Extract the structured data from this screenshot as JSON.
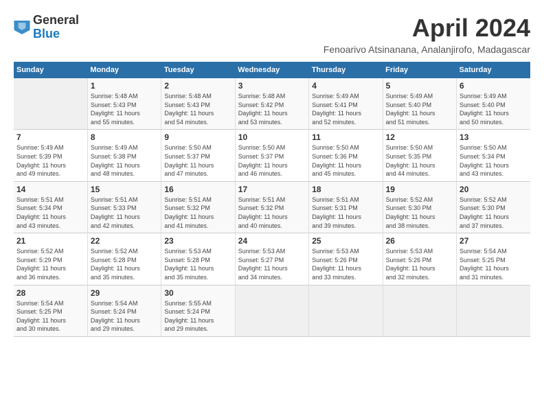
{
  "header": {
    "logo_general": "General",
    "logo_blue": "Blue",
    "title": "April 2024",
    "location": "Fenoarivo Atsinanana, Analanjirofo, Madagascar"
  },
  "columns": [
    "Sunday",
    "Monday",
    "Tuesday",
    "Wednesday",
    "Thursday",
    "Friday",
    "Saturday"
  ],
  "weeks": [
    [
      {
        "day": "",
        "sunrise": "",
        "sunset": "",
        "daylight1": "",
        "daylight2": ""
      },
      {
        "day": "1",
        "sunrise": "Sunrise: 5:48 AM",
        "sunset": "Sunset: 5:43 PM",
        "daylight1": "Daylight: 11 hours",
        "daylight2": "and 55 minutes."
      },
      {
        "day": "2",
        "sunrise": "Sunrise: 5:48 AM",
        "sunset": "Sunset: 5:43 PM",
        "daylight1": "Daylight: 11 hours",
        "daylight2": "and 54 minutes."
      },
      {
        "day": "3",
        "sunrise": "Sunrise: 5:48 AM",
        "sunset": "Sunset: 5:42 PM",
        "daylight1": "Daylight: 11 hours",
        "daylight2": "and 53 minutes."
      },
      {
        "day": "4",
        "sunrise": "Sunrise: 5:49 AM",
        "sunset": "Sunset: 5:41 PM",
        "daylight1": "Daylight: 11 hours",
        "daylight2": "and 52 minutes."
      },
      {
        "day": "5",
        "sunrise": "Sunrise: 5:49 AM",
        "sunset": "Sunset: 5:40 PM",
        "daylight1": "Daylight: 11 hours",
        "daylight2": "and 51 minutes."
      },
      {
        "day": "6",
        "sunrise": "Sunrise: 5:49 AM",
        "sunset": "Sunset: 5:40 PM",
        "daylight1": "Daylight: 11 hours",
        "daylight2": "and 50 minutes."
      }
    ],
    [
      {
        "day": "7",
        "sunrise": "Sunrise: 5:49 AM",
        "sunset": "Sunset: 5:39 PM",
        "daylight1": "Daylight: 11 hours",
        "daylight2": "and 49 minutes."
      },
      {
        "day": "8",
        "sunrise": "Sunrise: 5:49 AM",
        "sunset": "Sunset: 5:38 PM",
        "daylight1": "Daylight: 11 hours",
        "daylight2": "and 48 minutes."
      },
      {
        "day": "9",
        "sunrise": "Sunrise: 5:50 AM",
        "sunset": "Sunset: 5:37 PM",
        "daylight1": "Daylight: 11 hours",
        "daylight2": "and 47 minutes."
      },
      {
        "day": "10",
        "sunrise": "Sunrise: 5:50 AM",
        "sunset": "Sunset: 5:37 PM",
        "daylight1": "Daylight: 11 hours",
        "daylight2": "and 46 minutes."
      },
      {
        "day": "11",
        "sunrise": "Sunrise: 5:50 AM",
        "sunset": "Sunset: 5:36 PM",
        "daylight1": "Daylight: 11 hours",
        "daylight2": "and 45 minutes."
      },
      {
        "day": "12",
        "sunrise": "Sunrise: 5:50 AM",
        "sunset": "Sunset: 5:35 PM",
        "daylight1": "Daylight: 11 hours",
        "daylight2": "and 44 minutes."
      },
      {
        "day": "13",
        "sunrise": "Sunrise: 5:50 AM",
        "sunset": "Sunset: 5:34 PM",
        "daylight1": "Daylight: 11 hours",
        "daylight2": "and 43 minutes."
      }
    ],
    [
      {
        "day": "14",
        "sunrise": "Sunrise: 5:51 AM",
        "sunset": "Sunset: 5:34 PM",
        "daylight1": "Daylight: 11 hours",
        "daylight2": "and 43 minutes."
      },
      {
        "day": "15",
        "sunrise": "Sunrise: 5:51 AM",
        "sunset": "Sunset: 5:33 PM",
        "daylight1": "Daylight: 11 hours",
        "daylight2": "and 42 minutes."
      },
      {
        "day": "16",
        "sunrise": "Sunrise: 5:51 AM",
        "sunset": "Sunset: 5:32 PM",
        "daylight1": "Daylight: 11 hours",
        "daylight2": "and 41 minutes."
      },
      {
        "day": "17",
        "sunrise": "Sunrise: 5:51 AM",
        "sunset": "Sunset: 5:32 PM",
        "daylight1": "Daylight: 11 hours",
        "daylight2": "and 40 minutes."
      },
      {
        "day": "18",
        "sunrise": "Sunrise: 5:51 AM",
        "sunset": "Sunset: 5:31 PM",
        "daylight1": "Daylight: 11 hours",
        "daylight2": "and 39 minutes."
      },
      {
        "day": "19",
        "sunrise": "Sunrise: 5:52 AM",
        "sunset": "Sunset: 5:30 PM",
        "daylight1": "Daylight: 11 hours",
        "daylight2": "and 38 minutes."
      },
      {
        "day": "20",
        "sunrise": "Sunrise: 5:52 AM",
        "sunset": "Sunset: 5:30 PM",
        "daylight1": "Daylight: 11 hours",
        "daylight2": "and 37 minutes."
      }
    ],
    [
      {
        "day": "21",
        "sunrise": "Sunrise: 5:52 AM",
        "sunset": "Sunset: 5:29 PM",
        "daylight1": "Daylight: 11 hours",
        "daylight2": "and 36 minutes."
      },
      {
        "day": "22",
        "sunrise": "Sunrise: 5:52 AM",
        "sunset": "Sunset: 5:28 PM",
        "daylight1": "Daylight: 11 hours",
        "daylight2": "and 35 minutes."
      },
      {
        "day": "23",
        "sunrise": "Sunrise: 5:53 AM",
        "sunset": "Sunset: 5:28 PM",
        "daylight1": "Daylight: 11 hours",
        "daylight2": "and 35 minutes."
      },
      {
        "day": "24",
        "sunrise": "Sunrise: 5:53 AM",
        "sunset": "Sunset: 5:27 PM",
        "daylight1": "Daylight: 11 hours",
        "daylight2": "and 34 minutes."
      },
      {
        "day": "25",
        "sunrise": "Sunrise: 5:53 AM",
        "sunset": "Sunset: 5:26 PM",
        "daylight1": "Daylight: 11 hours",
        "daylight2": "and 33 minutes."
      },
      {
        "day": "26",
        "sunrise": "Sunrise: 5:53 AM",
        "sunset": "Sunset: 5:26 PM",
        "daylight1": "Daylight: 11 hours",
        "daylight2": "and 32 minutes."
      },
      {
        "day": "27",
        "sunrise": "Sunrise: 5:54 AM",
        "sunset": "Sunset: 5:25 PM",
        "daylight1": "Daylight: 11 hours",
        "daylight2": "and 31 minutes."
      }
    ],
    [
      {
        "day": "28",
        "sunrise": "Sunrise: 5:54 AM",
        "sunset": "Sunset: 5:25 PM",
        "daylight1": "Daylight: 11 hours",
        "daylight2": "and 30 minutes."
      },
      {
        "day": "29",
        "sunrise": "Sunrise: 5:54 AM",
        "sunset": "Sunset: 5:24 PM",
        "daylight1": "Daylight: 11 hours",
        "daylight2": "and 29 minutes."
      },
      {
        "day": "30",
        "sunrise": "Sunrise: 5:55 AM",
        "sunset": "Sunset: 5:24 PM",
        "daylight1": "Daylight: 11 hours",
        "daylight2": "and 29 minutes."
      },
      {
        "day": "",
        "sunrise": "",
        "sunset": "",
        "daylight1": "",
        "daylight2": ""
      },
      {
        "day": "",
        "sunrise": "",
        "sunset": "",
        "daylight1": "",
        "daylight2": ""
      },
      {
        "day": "",
        "sunrise": "",
        "sunset": "",
        "daylight1": "",
        "daylight2": ""
      },
      {
        "day": "",
        "sunrise": "",
        "sunset": "",
        "daylight1": "",
        "daylight2": ""
      }
    ]
  ]
}
